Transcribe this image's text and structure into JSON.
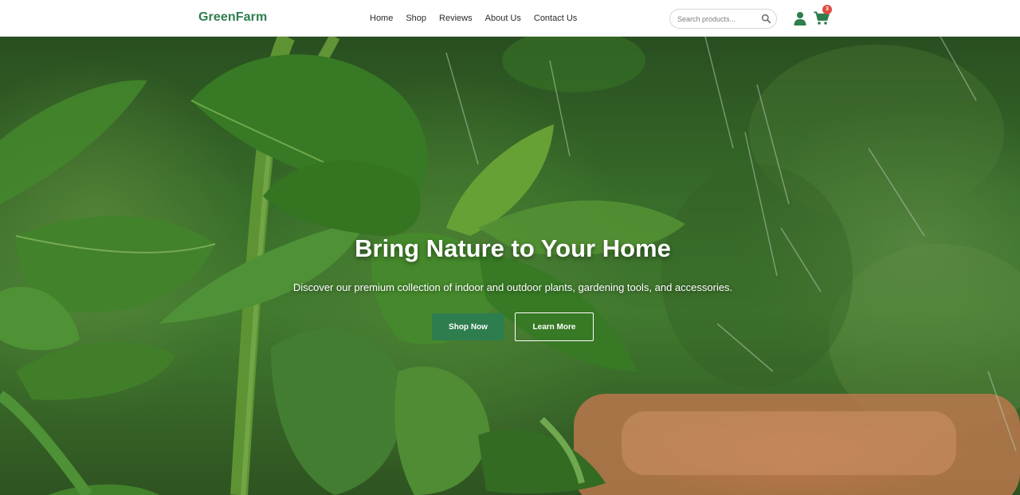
{
  "brand": {
    "name": "GreenFarm",
    "color": "#2e7d4f"
  },
  "nav": {
    "items": [
      {
        "label": "Home"
      },
      {
        "label": "Shop"
      },
      {
        "label": "Reviews"
      },
      {
        "label": "About Us"
      },
      {
        "label": "Contact Us"
      }
    ]
  },
  "search": {
    "placeholder": "Search products...",
    "value": "",
    "icon": "search-icon"
  },
  "account": {
    "icon": "user-icon"
  },
  "cart": {
    "icon": "shopping-cart-icon",
    "count": "3",
    "badge_color": "#e04a3f"
  },
  "hero": {
    "title": "Bring Nature to Your Home",
    "subtitle": "Discover our premium collection of indoor and outdoor plants, gardening tools, and accessories.",
    "primary_button": "Shop Now",
    "secondary_button": "Learn More",
    "background_image": "green plant leaves in rain"
  }
}
